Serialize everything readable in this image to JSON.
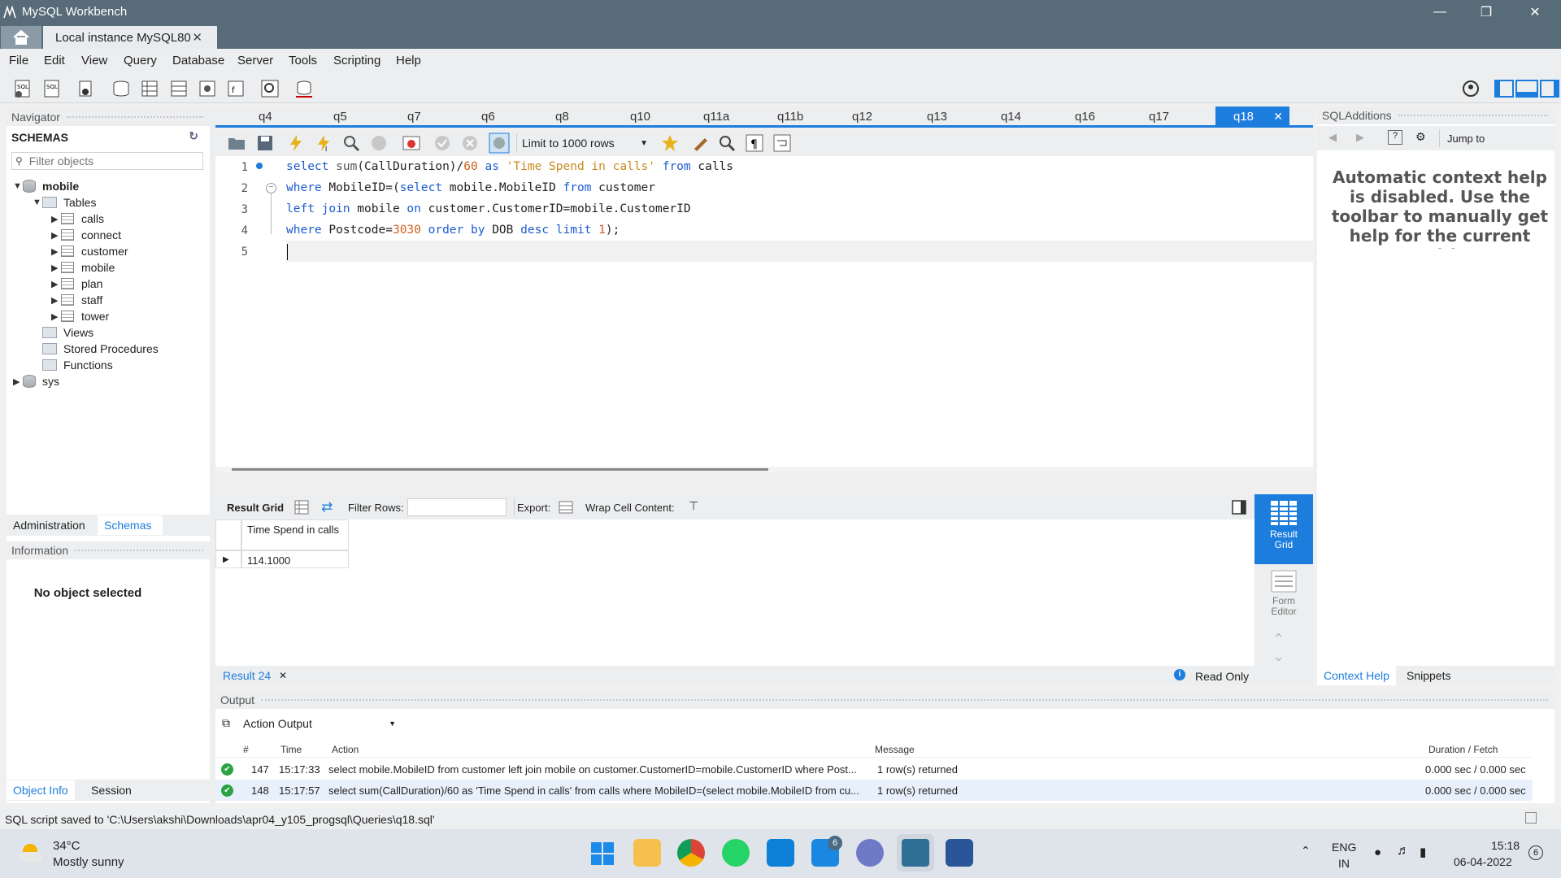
{
  "window": {
    "title": "MySQL Workbench",
    "connection_tab": "Local instance MySQL80"
  },
  "menu": [
    "File",
    "Edit",
    "View",
    "Query",
    "Database",
    "Server",
    "Tools",
    "Scripting",
    "Help"
  ],
  "navigator": {
    "header": "Navigator",
    "schemas_title": "SCHEMAS",
    "filter_placeholder": "Filter objects",
    "db_mobile": "mobile",
    "tables_label": "Tables",
    "tables": [
      "calls",
      "connect",
      "customer",
      "mobile",
      "plan",
      "staff",
      "tower"
    ],
    "views": "Views",
    "procedures": "Stored Procedures",
    "functions": "Functions",
    "db_sys": "sys",
    "tab_admin": "Administration",
    "tab_schemas": "Schemas"
  },
  "information": {
    "header": "Information",
    "message": "No object selected",
    "tab_objinfo": "Object Info",
    "tab_session": "Session"
  },
  "query_tabs": [
    "q4",
    "q5",
    "q7",
    "q6",
    "q8",
    "q10",
    "q11a",
    "q11b",
    "q12",
    "q13",
    "q14",
    "q16",
    "q17"
  ],
  "active_tab": "q18",
  "editor_toolbar": {
    "limit": "Limit to 1000 rows"
  },
  "editor": {
    "line_numbers": [
      "1",
      "2",
      "3",
      "4",
      "5"
    ],
    "l1": {
      "a": "select",
      "b": " sum",
      "c": "(CallDuration)/",
      "d": "60",
      "e": " as ",
      "f": "'Time Spend in calls'",
      "g": " from",
      "h": " calls"
    },
    "l2": {
      "a": "where",
      "b": " MobileID=(",
      "c": "select",
      "d": " mobile.MobileID ",
      "e": "from",
      "f": " customer"
    },
    "l3": {
      "a": "left join",
      "b": " mobile ",
      "c": "on",
      "d": " customer.CustomerID=mobile.CustomerID"
    },
    "l4": {
      "a": "where",
      "b": " Postcode=",
      "c": "3030",
      "d": " order by",
      "e": " DOB ",
      "f": "desc",
      "g": " limit",
      "h": " 1",
      "i": ");"
    }
  },
  "result": {
    "toolbar": {
      "grid": "Result Grid",
      "filter": "Filter Rows:",
      "export": "Export:",
      "wrap": "Wrap Cell Content:"
    },
    "column": "Time Spend in calls",
    "value": "114.1000",
    "side_result": "Result Grid",
    "side_form": "Form Editor",
    "tab": "Result 24",
    "readonly": "Read Only"
  },
  "sql_additions": {
    "header": "SQLAdditions",
    "jump": "Jump to",
    "help_text": "Automatic context help is disabled. Use the toolbar to manually get help for the current caret position or to toggle automatic help.",
    "tab_context": "Context Help",
    "tab_snippets": "Snippets"
  },
  "output": {
    "header": "Output",
    "selector": "Action Output",
    "columns": {
      "num": "#",
      "time": "Time",
      "action": "Action",
      "message": "Message",
      "duration": "Duration / Fetch"
    },
    "rows": [
      {
        "num": "147",
        "time": "15:17:33",
        "action": "select mobile.MobileID from customer  left join mobile on customer.CustomerID=mobile.CustomerID  where Post...",
        "message": "1 row(s) returned",
        "duration": "0.000 sec / 0.000 sec"
      },
      {
        "num": "148",
        "time": "15:17:57",
        "action": "select sum(CallDuration)/60 as 'Time Spend in calls' from calls where MobileID=(select mobile.MobileID from cu...",
        "message": "1 row(s) returned",
        "duration": "0.000 sec / 0.000 sec"
      }
    ]
  },
  "status": "SQL script saved to 'C:\\Users\\akshi\\Downloads\\apr04_y105_progsql\\Queries\\q18.sql'",
  "taskbar": {
    "weather_temp": "34°C",
    "weather_desc": "Mostly sunny",
    "badge": "6",
    "lang1": "ENG",
    "lang2": "IN",
    "time": "15:18",
    "date": "06-04-2022",
    "notif": "6"
  },
  "colors": {
    "accent": "#1d7ddc",
    "titlebar": "#586b78",
    "keyword": "#1c5bd0",
    "string": "#c98a1a"
  }
}
